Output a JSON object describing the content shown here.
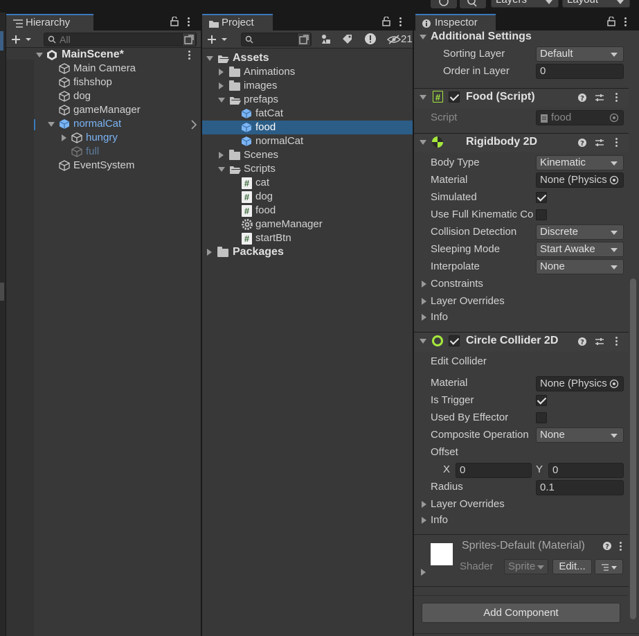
{
  "topbar": {
    "layers_label": "Layers",
    "layout_label": "Layout"
  },
  "hierarchy": {
    "tab_label": "Hierarchy",
    "search_placeholder": "All",
    "scene_name": "MainScene*",
    "items": [
      {
        "label": "Main Camera"
      },
      {
        "label": "fishshop"
      },
      {
        "label": "dog"
      },
      {
        "label": "gameManager"
      },
      {
        "label": "normalCat"
      },
      {
        "label": "hungry"
      },
      {
        "label": "full"
      },
      {
        "label": "EventSystem"
      }
    ]
  },
  "project": {
    "tab_label": "Project",
    "hidden_count": "21",
    "tree": [
      {
        "label": "Assets"
      },
      {
        "label": "Animations"
      },
      {
        "label": "images"
      },
      {
        "label": "prefaps"
      },
      {
        "label": "fatCat"
      },
      {
        "label": "food"
      },
      {
        "label": "normalCat"
      },
      {
        "label": "Scenes"
      },
      {
        "label": "Scripts"
      },
      {
        "label": "cat"
      },
      {
        "label": "dog"
      },
      {
        "label": "food"
      },
      {
        "label": "gameManager"
      },
      {
        "label": "startBtn"
      },
      {
        "label": "Packages"
      }
    ]
  },
  "inspector": {
    "tab_label": "Inspector",
    "additional_settings": {
      "title": "Additional Settings",
      "sorting_layer_label": "Sorting Layer",
      "sorting_layer_value": "Default",
      "order_label": "Order in Layer",
      "order_value": "0"
    },
    "food_script": {
      "title": "Food (Script)",
      "script_label": "Script",
      "script_value": "food"
    },
    "rigidbody": {
      "title": "Rigidbody 2D",
      "body_type_label": "Body Type",
      "body_type_value": "Kinematic",
      "material_label": "Material",
      "material_value": "None (Physics",
      "simulated_label": "Simulated",
      "full_kinematic_label": "Use Full Kinematic Co",
      "collision_label": "Collision Detection",
      "collision_value": "Discrete",
      "sleeping_label": "Sleeping Mode",
      "sleeping_value": "Start Awake",
      "interpolate_label": "Interpolate",
      "interpolate_value": "None",
      "constraints_label": "Constraints",
      "layer_overrides_label": "Layer Overrides",
      "info_label": "Info"
    },
    "circle_collider": {
      "title": "Circle Collider 2D",
      "edit_label": "Edit Collider",
      "material_label": "Material",
      "material_value": "None (Physics",
      "trigger_label": "Is Trigger",
      "effector_label": "Used By Effector",
      "composite_label": "Composite Operation",
      "composite_value": "None",
      "offset_label": "Offset",
      "x_label": "X",
      "x_value": "0",
      "y_label": "Y",
      "y_value": "0",
      "radius_label": "Radius",
      "radius_value": "0.1",
      "layer_overrides_label": "Layer Overrides",
      "info_label": "Info"
    },
    "material": {
      "title": "Sprites-Default (Material)",
      "shader_label": "Shader",
      "shader_value": "Sprite",
      "edit_label": "Edit..."
    },
    "add_component_label": "Add Component"
  },
  "colors": {
    "selection": "#2c5d87",
    "accent_blue": "#7bb5f5",
    "green": "#a5e83c"
  }
}
